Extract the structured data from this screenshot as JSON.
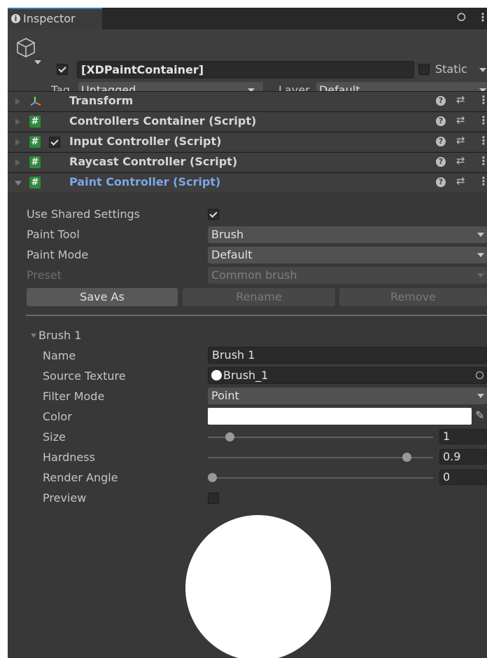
{
  "tab": {
    "title": "Inspector",
    "info_icon": "i"
  },
  "header": {
    "object_name": "[XDPaintContainer]",
    "active_checked": true,
    "static_label": "Static",
    "tag_label": "Tag",
    "tag_value": "Untagged",
    "layer_label": "Layer",
    "layer_value": "Default"
  },
  "components": [
    {
      "name": "Transform",
      "icon": "transform-axes-icon",
      "expanded": false,
      "has_checkbox": false
    },
    {
      "name": "Controllers Container (Script)",
      "icon": "script-icon",
      "expanded": false,
      "has_checkbox": false
    },
    {
      "name": "Input Controller (Script)",
      "icon": "script-icon",
      "expanded": false,
      "has_checkbox": true,
      "checked": true
    },
    {
      "name": "Raycast Controller (Script)",
      "icon": "script-icon",
      "expanded": false,
      "has_checkbox": false
    },
    {
      "name": "Paint Controller (Script)",
      "icon": "script-icon",
      "expanded": true,
      "has_checkbox": false
    }
  ],
  "component_icons": {
    "script": "#",
    "help": "?",
    "presets": "⇄",
    "menu": "⋮"
  },
  "paint_controller": {
    "use_shared_settings": {
      "label": "Use Shared Settings",
      "checked": true
    },
    "paint_tool": {
      "label": "Paint Tool",
      "value": "Brush"
    },
    "paint_mode": {
      "label": "Paint Mode",
      "value": "Default"
    },
    "preset": {
      "label": "Preset",
      "value": "Common brush"
    },
    "buttons": {
      "save_as": "Save As",
      "rename": "Rename",
      "remove": "Remove"
    },
    "brush": {
      "header": "Brush 1",
      "name": {
        "label": "Name",
        "value": "Brush 1"
      },
      "source_texture": {
        "label": "Source Texture",
        "value": "Brush_1"
      },
      "filter_mode": {
        "label": "Filter Mode",
        "value": "Point"
      },
      "color": {
        "label": "Color",
        "value": "#ffffff"
      },
      "size": {
        "label": "Size",
        "value": "1",
        "fraction": 0.08
      },
      "hardness": {
        "label": "Hardness",
        "value": "0.9",
        "fraction": 0.9
      },
      "render_angle": {
        "label": "Render Angle",
        "value": "0",
        "fraction": 0.0
      },
      "preview": {
        "label": "Preview",
        "checked": false
      }
    }
  },
  "colors": {
    "accent_blue": "#7ba7e6",
    "script_green": "#2f8a3b",
    "panel": "#383838"
  }
}
